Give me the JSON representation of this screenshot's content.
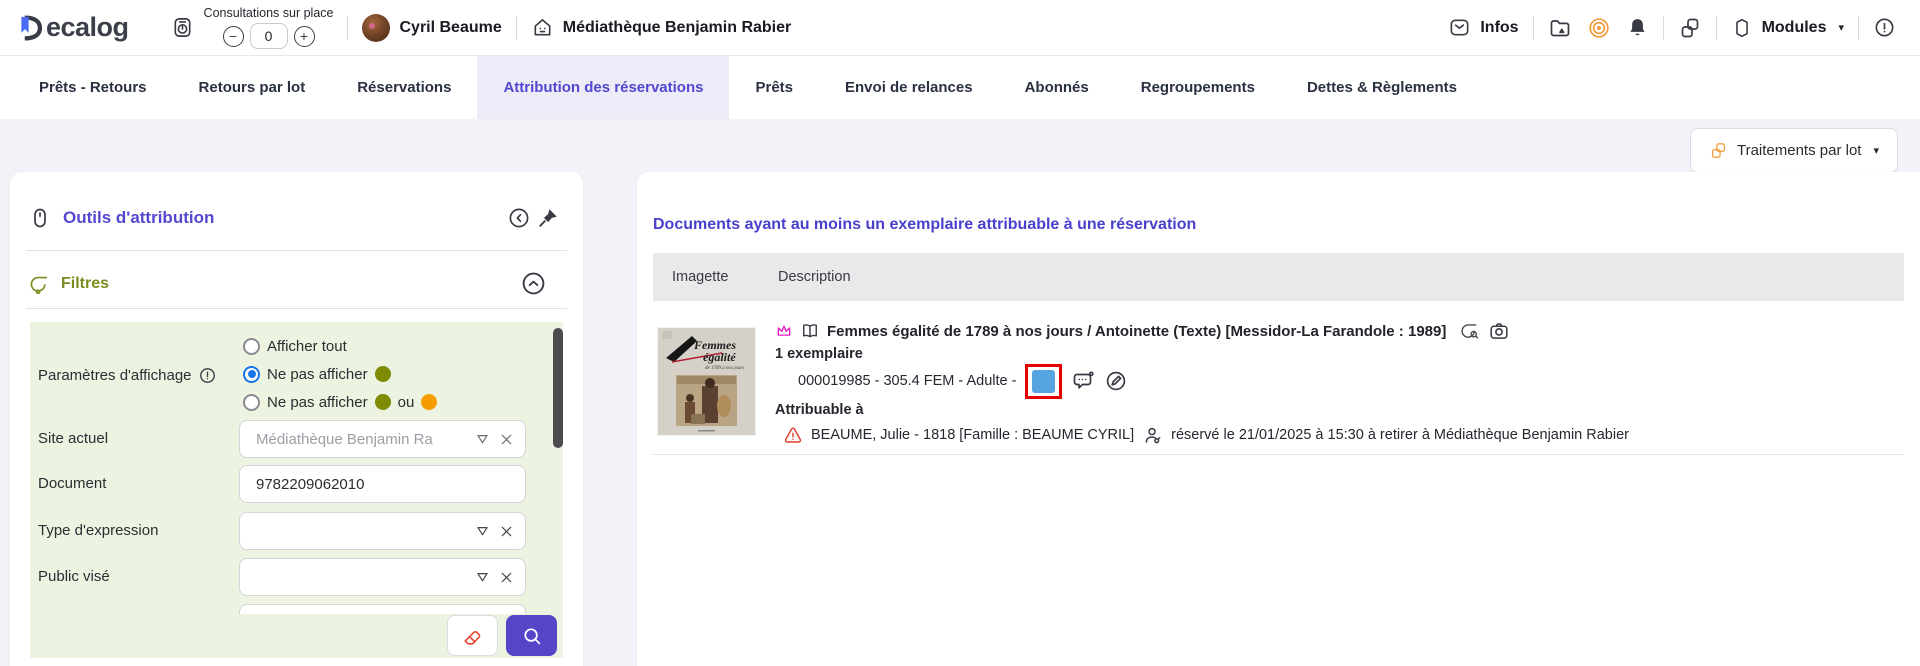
{
  "header": {
    "logo_text": "ecalog",
    "logo_full": "Decalog",
    "consultations_label": "Consultations sur place",
    "consultations_value": "0",
    "minus_label": "−",
    "plus_label": "+",
    "user_name": "Cyril Beaume",
    "site_name": "Médiathèque Benjamin Rabier",
    "infos_label": "Infos",
    "modules_label": "Modules",
    "caret": "▾"
  },
  "tabs": {
    "items": [
      {
        "label": "Prêts - Retours"
      },
      {
        "label": "Retours par lot"
      },
      {
        "label": "Réservations"
      },
      {
        "label": "Attribution des réservations"
      },
      {
        "label": "Prêts"
      },
      {
        "label": "Envoi de relances"
      },
      {
        "label": "Abonnés"
      },
      {
        "label": "Regroupements"
      },
      {
        "label": "Dettes & Règlements"
      }
    ],
    "active_index": 3
  },
  "toolbar": {
    "batch_button_label": "Traitements par lot",
    "caret": "▾"
  },
  "attribution_panel": {
    "title": "Outils d'attribution",
    "filters": {
      "title": "Filtres",
      "display_settings_label": "Paramètres d'affichage",
      "radios": [
        {
          "label": "Afficher tout",
          "selected": false
        },
        {
          "label": "Ne pas afficher",
          "selected": true
        },
        {
          "label": "Ne pas afficher",
          "or_text": "ou",
          "selected": false
        }
      ],
      "fields": [
        {
          "label": "Site actuel",
          "value": "Médiathèque Benjamin Ra"
        },
        {
          "label": "Document",
          "value": "9782209062010"
        },
        {
          "label": "Type d'expression",
          "value": ""
        },
        {
          "label": "Public visé",
          "value": ""
        }
      ]
    }
  },
  "results": {
    "title": "Documents ayant au moins un exemplaire attribuable à une réservation",
    "columns": {
      "imagette": "Imagette",
      "description": "Description"
    },
    "document": {
      "title": "Femmes égalité de 1789 à nos jours / Antoinette (Texte) [Messidor-La Farandole : 1989]",
      "copies_label": "1 exemplaire",
      "item_info": "000019985 - 305.4 FEM - Adulte -",
      "attributable_label": "Attribuable à",
      "reservation_holder": "BEAUME, Julie - 1818 [Famille : BEAUME CYRIL]",
      "reservation_details": "réservé le 21/01/2025 à 15:30 à retirer à Médiathèque Benjamin Rabier"
    }
  },
  "colors": {
    "accent_purple": "#5347d0",
    "title_purple": "#4a40cc",
    "olive_green": "#7d8b1f",
    "status_olive_dot": "#7d8b05",
    "status_orange_dot": "#f59d00",
    "orange_icon": "#f29a3e",
    "item_blue_square": "#57a5e0",
    "annotation_red": "#e60000",
    "warning_red": "#e23c2c",
    "search_button_purple": "#5546c8",
    "eraser_red": "#e8402c",
    "logo_blue": "#4a6bf5",
    "form_green_bg": "#edf3e1",
    "page_bg": "#f2f3f8"
  }
}
